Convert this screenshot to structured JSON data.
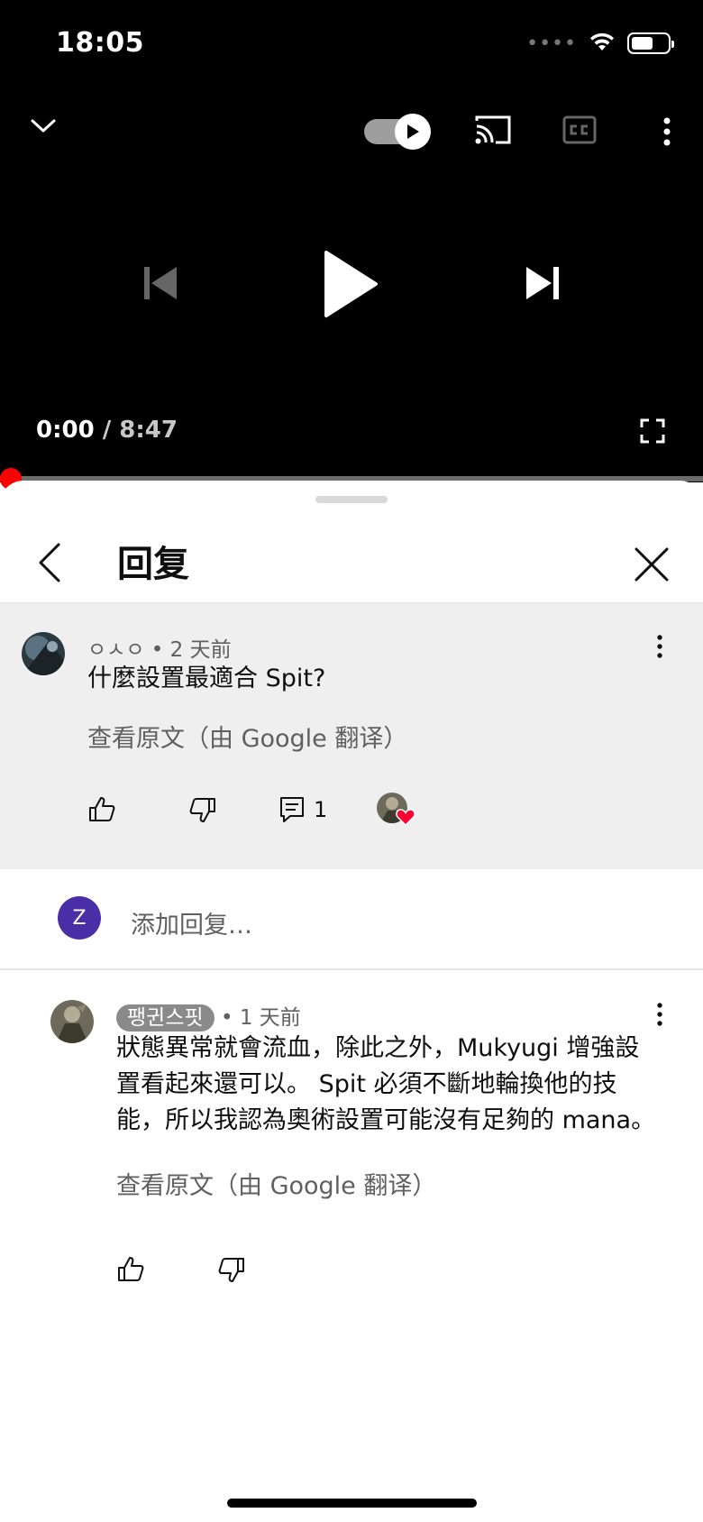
{
  "status_bar": {
    "time": "18:05",
    "signal": "••••",
    "battery_level": 0.6
  },
  "player": {
    "current_time": "0:00",
    "separator": " / ",
    "duration": "8:47",
    "autoplay_on": true,
    "progress_fraction": 0.0,
    "accent_color": "#ff0000"
  },
  "sheet": {
    "title": "回复"
  },
  "parent_comment": {
    "author": "ㅇㅅㅇ",
    "age": "• 2 天前",
    "text": "什麼設置最適合 Spit?",
    "translate_label": "查看原文（由 Google 翻译）",
    "reply_count": "1"
  },
  "add_reply": {
    "avatar_letter": "Z",
    "placeholder": "添加回复…",
    "avatar_color": "#4a2ea8"
  },
  "reply": {
    "author": "팽귄스핏",
    "age": "• 1 天前",
    "text_lines": [
      "狀態異常就會流血，除此之外，Mukyugi 增強設",
      "置看起來還可以。 Spit 必須不斷地輪換他的技",
      "能，所以我認為奧術設置可能沒有足夠的 mana。"
    ],
    "translate_label": "查看原文（由 Google 翻译）"
  }
}
